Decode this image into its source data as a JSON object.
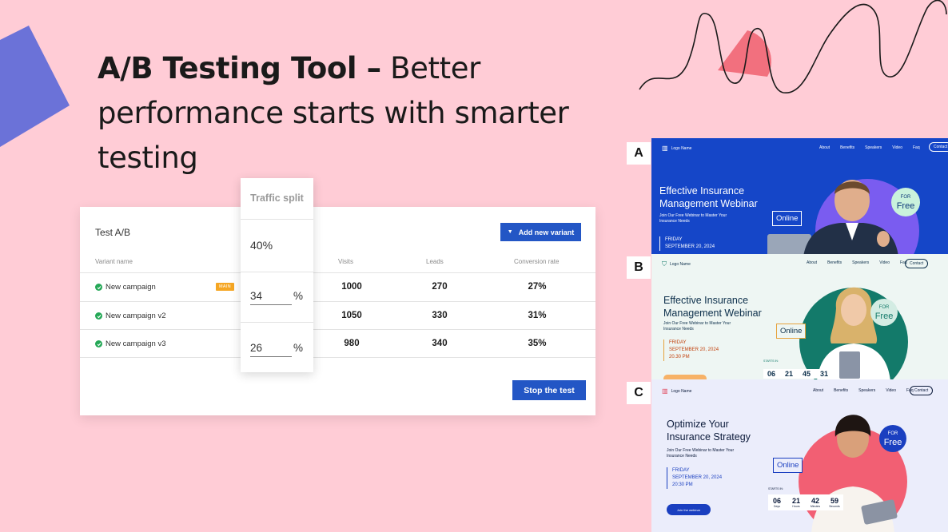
{
  "headline": {
    "bold": "A/B Testing Tool –",
    "rest": " Better performance starts with smarter testing"
  },
  "card": {
    "title": "Test A/B",
    "add_button": "Add new variant",
    "columns": {
      "name": "Variant name",
      "visits": "Visits",
      "leads": "Leads",
      "conversion": "Conversion rate"
    },
    "rows": [
      {
        "name": "New campaign",
        "badge": "MAIN",
        "visits": "1000",
        "leads": "270",
        "conversion": "27%"
      },
      {
        "name": "New campaign v2",
        "visits": "1050",
        "leads": "330",
        "conversion": "31%"
      },
      {
        "name": "New campaign v3",
        "visits": "980",
        "leads": "340",
        "conversion": "35%"
      }
    ],
    "stop_button": "Stop the test"
  },
  "split": {
    "title": "Traffic split",
    "main_value": "40%",
    "v2_value": "34",
    "v3_value": "26",
    "unit": "%"
  },
  "variants": {
    "a": {
      "label": "A",
      "logo": "Logo Name",
      "nav": [
        "About",
        "Benefits",
        "Speakers",
        "Video",
        "Faq"
      ],
      "contact": "Contact",
      "heading_1": "Effective Insurance",
      "heading_2": "Management Webinar",
      "sub_1": "Join Our Free Webinar to Master Your",
      "sub_2": "Insurance Needs",
      "day": "FRIDAY",
      "date": "SEPTEMBER 20, 2024",
      "online": "Online",
      "for": "FOR",
      "free": "Free",
      "bg": "#1546c8"
    },
    "b": {
      "label": "B",
      "logo": "Logo Name",
      "nav": [
        "About",
        "Benefits",
        "Speakers",
        "Video",
        "Faq"
      ],
      "contact": "Contact",
      "heading_1": "Effective Insurance",
      "heading_2": "Management Webinar",
      "sub_1": "Join Our Free Webinar to Master Your",
      "sub_2": "Insurance Needs",
      "day": "FRIDAY",
      "date": "SEPTEMBER 20, 2024",
      "time": "20.30 PM",
      "online": "Online",
      "for": "FOR",
      "free": "Free",
      "starts_in": "STARTS IN:",
      "countdown": [
        "06",
        "21",
        "45",
        "31"
      ],
      "bg": "#eef6f3"
    },
    "c": {
      "label": "C",
      "logo": "Logo Name",
      "nav": [
        "About",
        "Benefits",
        "Speakers",
        "Video",
        "Faq"
      ],
      "contact": "Contact",
      "heading_1": "Optimize Your",
      "heading_2": "Insurance Strategy",
      "sub_1": "Join Our Free Webinar to Master Your",
      "sub_2": "Insurance Needs",
      "day": "FRIDAY",
      "date": "SEPTEMBER 20, 2024",
      "time": "20:30 PM",
      "online": "Online",
      "for": "FOR",
      "free": "Free",
      "starts_in": "STARTS IN:",
      "countdown": [
        "06",
        "21",
        "42",
        "59"
      ],
      "countdown_units": [
        "Days",
        "Hours",
        "Minutes",
        "Seconds"
      ],
      "cta": "Join the webinar",
      "bg": "#ebedfb"
    }
  },
  "colors": {
    "background": "#ffccd6",
    "accent": "#2356c5",
    "badge": "#f5a623",
    "check": "#25a857",
    "decor_triangle": "#6b72d8",
    "decor_blob": "#f2707e"
  }
}
